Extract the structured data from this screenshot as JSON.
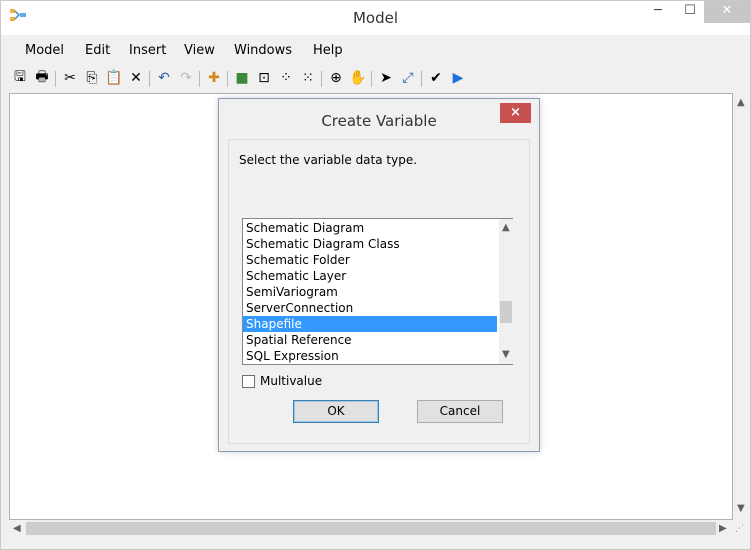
{
  "window": {
    "title": "Model"
  },
  "menubar": {
    "items": [
      "Model",
      "Edit",
      "Insert",
      "View",
      "Windows",
      "Help"
    ]
  },
  "toolbar": {
    "icons": [
      "save-icon",
      "print-icon",
      "cut-icon",
      "copy-icon",
      "paste-icon",
      "delete-icon",
      "undo-icon",
      "redo-icon",
      "add-data-icon",
      "auto-layout-icon",
      "full-extent-icon",
      "zoom-in-fixed-icon",
      "zoom-out-fixed-icon",
      "zoom-in-icon",
      "pan-icon",
      "select-icon",
      "connect-icon",
      "validate-icon",
      "run-icon"
    ],
    "glyphs": [
      "🖫",
      "🖶",
      "✂",
      "⎘",
      "📋",
      "✕",
      "↶",
      "↷",
      "✚",
      "■",
      "⊡",
      "⁘",
      "⁙",
      "⊕",
      "✋",
      "➤",
      "⤢",
      "✔",
      "▶"
    ]
  },
  "dialog": {
    "title": "Create Variable",
    "close_glyph": "×",
    "prompt": "Select the variable data type.",
    "list_items": [
      "Schematic Diagram",
      "Schematic Diagram Class",
      "Schematic Folder",
      "Schematic Layer",
      "SemiVariogram",
      "ServerConnection",
      "Shapefile",
      "Spatial Reference",
      "SQL Expression"
    ],
    "selected_item": "Shapefile",
    "multivalue_label": "Multivalue",
    "ok_label": "OK",
    "cancel_label": "Cancel"
  },
  "colors": {
    "selection": "#3399ff",
    "close_button": "#c75050",
    "run_arrow": "#1e6fd9"
  }
}
